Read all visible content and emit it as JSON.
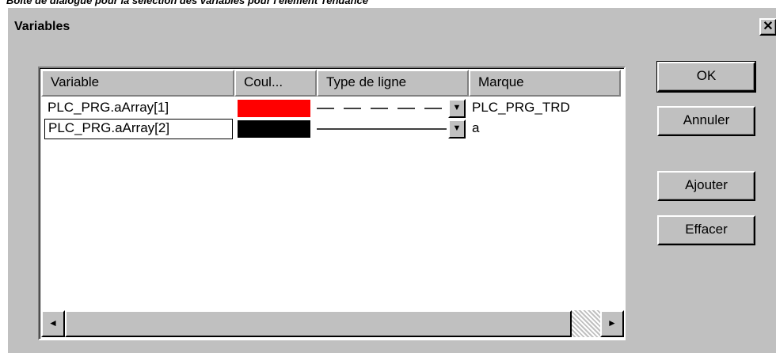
{
  "caption": "Boîte de dialogue pour la sélection des variables pour l'élément Tendance",
  "window": {
    "title": "Variables",
    "close_glyph": "✕"
  },
  "columns": [
    "Variable",
    "Coul...",
    "Type de ligne",
    "Marque"
  ],
  "rows": [
    {
      "variable": "PLC_PRG.aArray[1]",
      "color": "#ff0000",
      "line_type": "dashed",
      "marker": "PLC_PRG_TRD"
    },
    {
      "variable": "PLC_PRG.aArray[2]",
      "color": "#000000",
      "line_type": "solid",
      "marker": "a"
    }
  ],
  "dropdown_glyph": "▼",
  "scroll": {
    "left_glyph": "◄",
    "right_glyph": "►"
  },
  "buttons": {
    "ok": "OK",
    "cancel": "Annuler",
    "add": "Ajouter",
    "delete": "Effacer"
  }
}
